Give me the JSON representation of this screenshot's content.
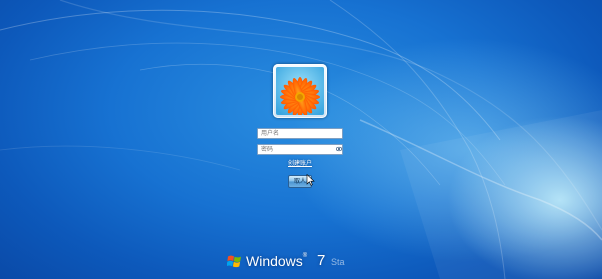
{
  "login": {
    "username_placeholder": "用户名",
    "password_placeholder": "密码",
    "create_account_link": "创建账户",
    "submit_label": "取人"
  },
  "branding": {
    "name": "Windows",
    "version": "7",
    "edition": "Sta"
  },
  "colors": {
    "background_dark": "#0a4aa8",
    "background_mid": "#1772d2",
    "glow": "#c8f5ff",
    "avatar_petals": "#ff7a12",
    "avatar_center": "#f3a600",
    "avatar_sky": "#4fc1ee"
  },
  "icons": [
    "user-avatar",
    "reveal-password-icon",
    "mouse-cursor-icon",
    "windows-flag-icon"
  ]
}
